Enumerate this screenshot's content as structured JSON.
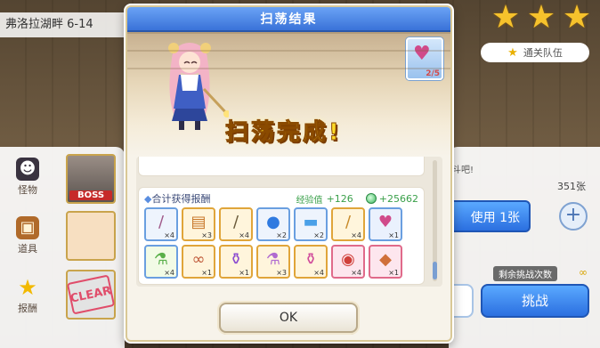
{
  "stage": {
    "title": "弗洛拉湖畔 6-14",
    "stars": 3
  },
  "team_button": "通关队伍",
  "left_panel": {
    "tabs": [
      {
        "label": "怪物",
        "icon": "monster-icon"
      },
      {
        "label": "道具",
        "icon": "chest-icon"
      },
      {
        "label": "报酬",
        "icon": "star-icon"
      }
    ],
    "boss_tag": "BOSS",
    "clear_stamp": "CLEAR"
  },
  "right_panel": {
    "hint": "斗吧!",
    "ticket_count": "351张",
    "use_button": "使用 1张",
    "plus": "+",
    "remaining_label": "剩余挑战次数",
    "remaining_value": "∞",
    "challenge_button": "挑战"
  },
  "modal": {
    "title": "扫荡结果",
    "banner_text": "扫荡完成!",
    "ticket_card": {
      "icon": "sweep-ticket-icon",
      "count": "2/5"
    },
    "rewards": {
      "title": "合计获得报酬",
      "exp_label": "经验值",
      "exp_value": "+126",
      "mana_value": "+25662",
      "items": [
        {
          "name": "wand-item",
          "qty": "×4",
          "border": "#6a9fe0",
          "bg": "#eef4fd",
          "glyph": "/",
          "color": "#a05a8a"
        },
        {
          "name": "book-item",
          "qty": "×3",
          "border": "#e0a53a",
          "bg": "#fff5dc",
          "glyph": "▤",
          "color": "#c8772a"
        },
        {
          "name": "staff-item",
          "qty": "×4",
          "border": "#e0a53a",
          "bg": "#fff5dc",
          "glyph": "/",
          "color": "#6a5a3a"
        },
        {
          "name": "orb-item",
          "qty": "×2",
          "border": "#6a9fe0",
          "bg": "#eef4fd",
          "glyph": "●",
          "color": "#2f7ae0"
        },
        {
          "name": "blue-ticket-item",
          "qty": "×2",
          "border": "#6a9fe0",
          "bg": "#eef4fd",
          "glyph": "▬",
          "color": "#4aa0e8"
        },
        {
          "name": "scepter-item",
          "qty": "×4",
          "border": "#e0a53a",
          "bg": "#fff5dc",
          "glyph": "/",
          "color": "#c88a2a"
        },
        {
          "name": "character-memory-item",
          "qty": "×1",
          "border": "#6a9fe0",
          "bg": "#eaf1fd",
          "glyph": "♥",
          "color": "#d04a8a"
        },
        {
          "name": "green-potion-item",
          "qty": "×4",
          "border": "#6a9fe0",
          "bg": "#f2fbe6",
          "glyph": "⚗",
          "color": "#59b04a"
        },
        {
          "name": "glasses-item",
          "qty": "×1",
          "border": "#e0a53a",
          "bg": "#fff5dc",
          "glyph": "∞",
          "color": "#c05a3a"
        },
        {
          "name": "bottle-item",
          "qty": "×1",
          "border": "#e0a53a",
          "bg": "#fff5dc",
          "glyph": "⚱",
          "color": "#8a4ad0"
        },
        {
          "name": "elixir-item",
          "qty": "×3",
          "border": "#e0a53a",
          "bg": "#fff5dc",
          "glyph": "⚗",
          "color": "#b06ad0"
        },
        {
          "name": "pink-potion-item",
          "qty": "×4",
          "border": "#e0a53a",
          "bg": "#fff5dc",
          "glyph": "⚱",
          "color": "#d04a9a"
        },
        {
          "name": "cake-item",
          "qty": "×4",
          "border": "#e06a8a",
          "bg": "#fde6ee",
          "glyph": "◉",
          "color": "#d0403a"
        },
        {
          "name": "crystal-item",
          "qty": "×1",
          "border": "#e06a8a",
          "bg": "#fde6ee",
          "glyph": "◆",
          "color": "#d0703a"
        }
      ]
    },
    "ok_button": "OK"
  }
}
